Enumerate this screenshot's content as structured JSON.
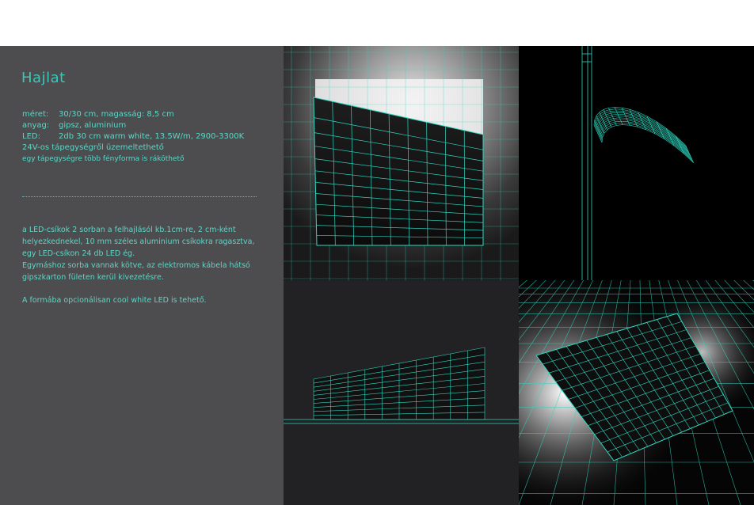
{
  "title": "Hajlat",
  "specs": [
    {
      "label": "méret:",
      "value": "30/30 cm, magasság:  8,5 cm"
    },
    {
      "label": "anyag:",
      "value": "gipsz, aluminium"
    },
    {
      "label": "LED:",
      "value": "2db 30 cm warm white, 13.5W/m, 2900-3300K"
    }
  ],
  "spec_notes": [
    "24V-os tápegységről üzemeltethető",
    "egy tápegységre több fényforma is ráköthető"
  ],
  "description": [
    "a LED-csíkok 2 sorban a felhajlásól kb.1cm-re,  2 cm-ként",
    "helyezkednekel, 10 mm széles aluminium csíkokra ragasztva,",
    "egy LED-csíkon 24 db  LED ég.",
    "Egymáshoz sorba vannak kötve, az elektromos kábela hátsó",
    "gipszkarton fületen kerül  kivezetésre."
  ],
  "note": "A formába opcionálisan cool white LED is tehető.",
  "colors": {
    "accent": "#38c9bb",
    "text": "#5fd4c6",
    "panel_bg": "#4d4d4f",
    "wire": "#2fd6c0"
  },
  "views": [
    "front-perspective-render",
    "side-profile-wireframe",
    "front-elevation-wireframe",
    "floor-perspective-render"
  ]
}
